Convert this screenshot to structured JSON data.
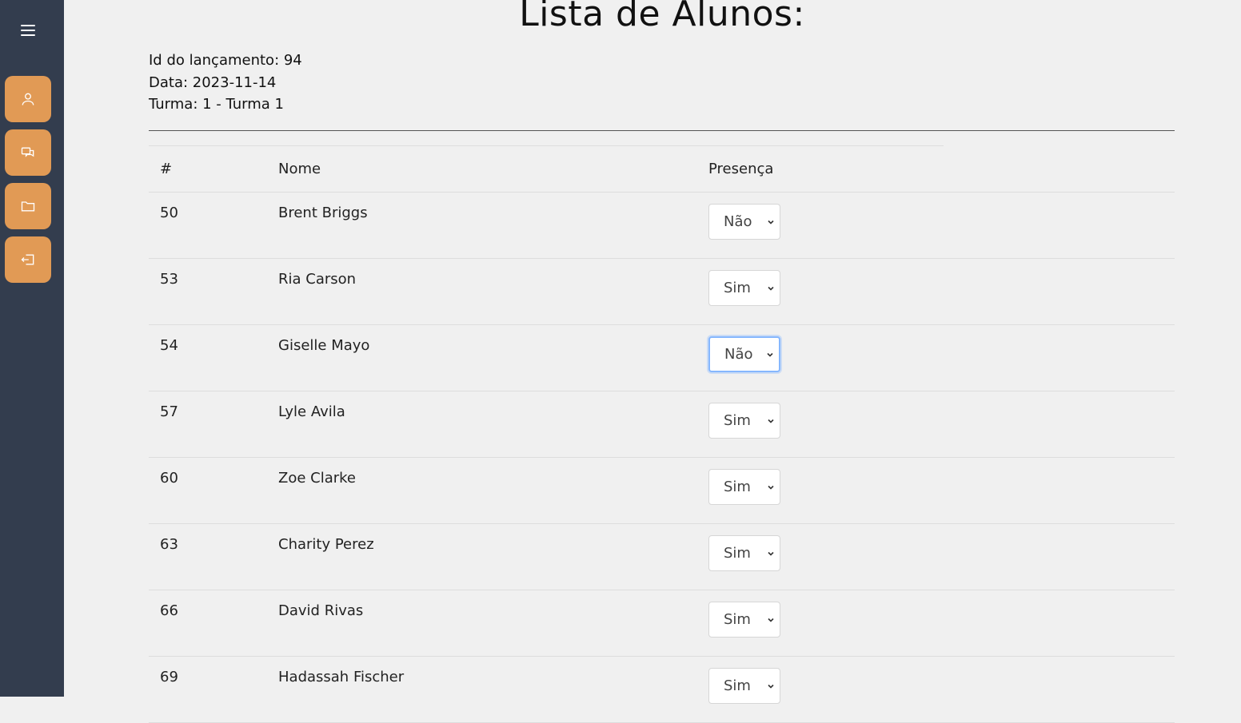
{
  "page": {
    "title": "Lista de Alunos:",
    "info": {
      "launch_id": "Id do lançamento: 94",
      "date": "Data: 2023-11-14",
      "class": "Turma: 1 - Turma 1"
    }
  },
  "sidebar": {
    "menu_icon": "hamburger-icon",
    "buttons": [
      {
        "icon": "user-icon"
      },
      {
        "icon": "chat-icon"
      },
      {
        "icon": "folder-icon"
      },
      {
        "icon": "logout-icon"
      }
    ],
    "accent": "#e19a55",
    "background": "#333d4e"
  },
  "table": {
    "headers": [
      "#",
      "Nome",
      "Presença"
    ],
    "rows": [
      {
        "id": "50",
        "name": "Brent Briggs",
        "presence": "Não"
      },
      {
        "id": "53",
        "name": "Ria Carson",
        "presence": "Sim"
      },
      {
        "id": "54",
        "name": "Giselle Mayo",
        "presence": "Não"
      },
      {
        "id": "57",
        "name": "Lyle Avila",
        "presence": "Sim"
      },
      {
        "id": "60",
        "name": "Zoe Clarke",
        "presence": "Sim"
      },
      {
        "id": "63",
        "name": "Charity Perez",
        "presence": "Sim"
      },
      {
        "id": "66",
        "name": "David Rivas",
        "presence": "Sim"
      },
      {
        "id": "69",
        "name": "Hadassah Fischer",
        "presence": "Sim"
      }
    ]
  }
}
